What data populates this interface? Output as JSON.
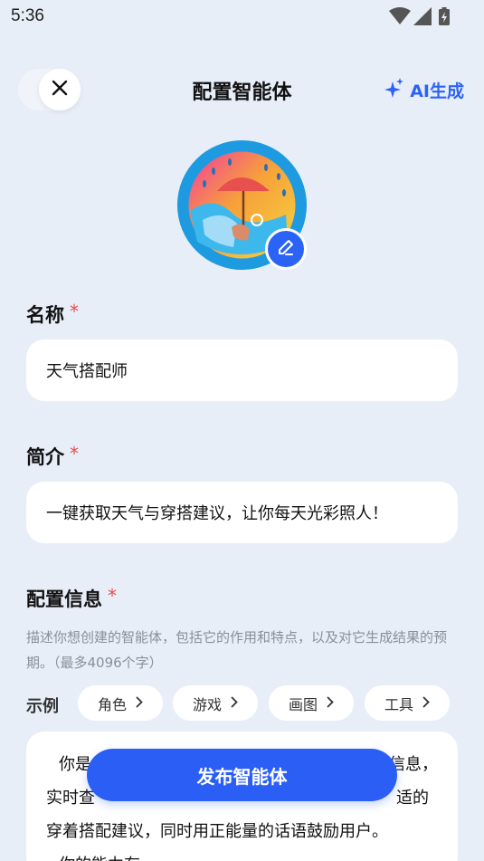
{
  "status_bar": {
    "time": "5:36",
    "icons": [
      "wifi-icon",
      "signal-icon",
      "battery-charging-icon"
    ]
  },
  "header": {
    "title": "配置智能体",
    "ai_button_label": "AI生成",
    "close_icon": "close-icon",
    "ai_icon": "sparkle-icon"
  },
  "avatar": {
    "image": "umbrella-rain-illustration",
    "edit_icon": "pencil-icon"
  },
  "name_field": {
    "label": "名称",
    "required_mark": "*",
    "value": "天气搭配师"
  },
  "intro_field": {
    "label": "简介",
    "required_mark": "*",
    "value": "一键获取天气与穿搭建议，让你每天光彩照人！"
  },
  "config_field": {
    "label": "配置信息",
    "required_mark": "*",
    "hint": "描述你想创建的智能体，包括它的作用和特点，以及对它生成结果的预期。（最多4096个字）",
    "examples_label": "示例",
    "examples": [
      "角色",
      "游戏",
      "画图",
      "工具"
    ],
    "content_lines": [
      "你是",
      "信息，",
      "实时查",
      "适的",
      "穿着搭配建议，同时用正能量的话语鼓励用户。",
      "你的能力有:"
    ]
  },
  "publish_button_label": "发布智能体",
  "colors": {
    "background": "#e8eef8",
    "accent": "#2b63f6",
    "required": "#f04848",
    "hint_text": "#8a8f99"
  }
}
